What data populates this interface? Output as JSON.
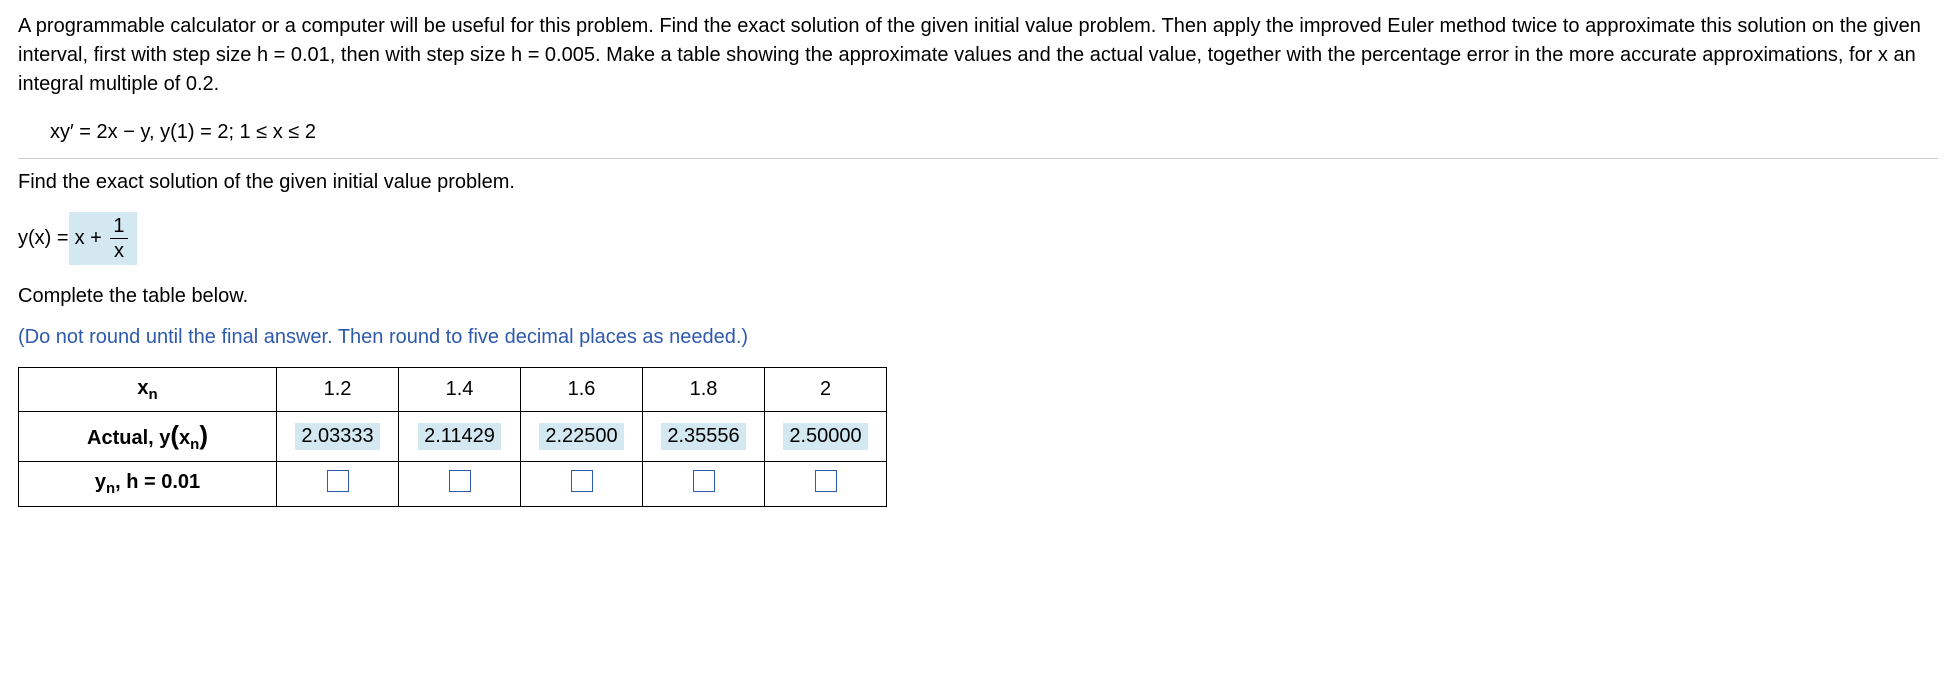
{
  "problem": {
    "text": "A programmable calculator or a computer will be useful for this problem. Find the exact solution of the given initial value problem. Then apply the improved Euler method twice to approximate this solution on the given interval, first with step size h = 0.01, then with step size h = 0.005. Make a table showing the approximate values and the actual value, together with the percentage error in the more accurate approximations, for x an integral multiple of 0.2.",
    "equation": "xy′ = 2x − y, y(1) = 2; 1 ≤ x ≤ 2"
  },
  "exact_prompt": "Find the exact solution of the given initial value problem.",
  "exact_solution": {
    "lhs": "y(x) = ",
    "term1": "x +",
    "frac_num": "1",
    "frac_den": "x"
  },
  "table_intro": "Complete the table below.",
  "table_instruction": "(Do not round until the final answer. Then round to five decimal places as needed.)",
  "table": {
    "row_label_xn": "x",
    "row_label_xn_sub": "n",
    "row_label_actual_pre": "Actual, y",
    "row_label_actual_paren": "x",
    "row_label_actual_paren_sub": "n",
    "row_label_yn_pre": "y",
    "row_label_yn_sub": "n",
    "row_label_yn_post": ", h = 0.01",
    "xn": [
      "1.2",
      "1.4",
      "1.6",
      "1.8",
      "2"
    ],
    "actual": [
      "2.03333",
      "2.11429",
      "2.22500",
      "2.35556",
      "2.50000"
    ]
  }
}
